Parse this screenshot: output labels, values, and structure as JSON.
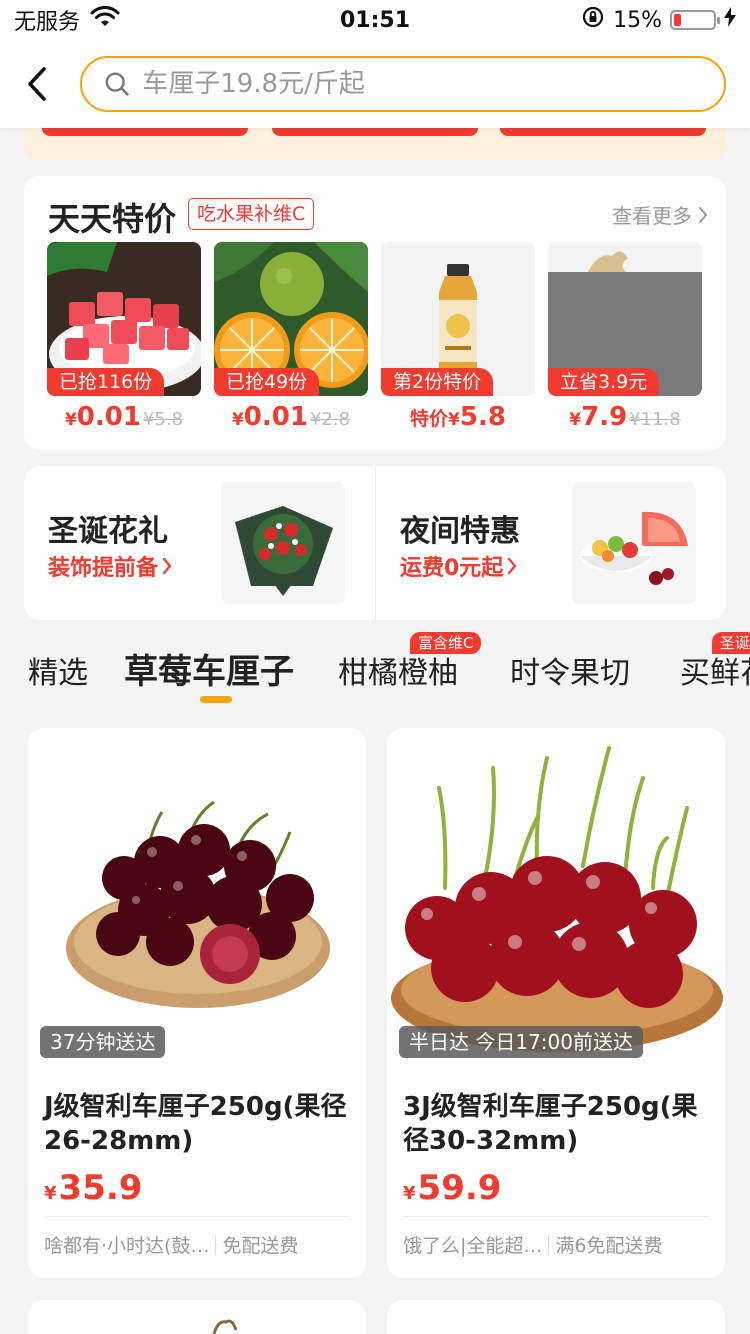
{
  "status_bar": {
    "carrier": "无服务",
    "time": "01:51",
    "battery": "15%"
  },
  "search": {
    "placeholder": "车厘子19.8元/斤起"
  },
  "daily_deals": {
    "title": "天天特价",
    "tag": "吃水果补维C",
    "more": "查看更多",
    "items": [
      {
        "badge": "已抢116份",
        "price_prefix": "",
        "currency": "¥",
        "price": "0.01",
        "original": "¥5.8"
      },
      {
        "badge": "已抢49份",
        "price_prefix": "",
        "currency": "¥",
        "price": "0.01",
        "original": "¥2.8"
      },
      {
        "badge": "第2份特价",
        "price_prefix": "特价",
        "currency": "¥",
        "price": "5.8",
        "original": ""
      },
      {
        "badge": "立省3.9元",
        "price_prefix": "",
        "currency": "¥",
        "price": "7.9",
        "original": "¥11.8"
      }
    ]
  },
  "promos": [
    {
      "title": "圣诞花礼",
      "subtitle": "装饰提前备"
    },
    {
      "title": "夜间特惠",
      "subtitle": "运费0元起"
    }
  ],
  "category_tabs": [
    {
      "label": "精选",
      "badge": ""
    },
    {
      "label": "草莓车厘子",
      "badge": ""
    },
    {
      "label": "柑橘橙柚",
      "badge": "富含维C"
    },
    {
      "label": "时令果切",
      "badge": ""
    },
    {
      "label": "买鲜花",
      "badge": "圣诞"
    }
  ],
  "products": [
    {
      "delivery_badge": "37分钟送达",
      "name": "J级智利车厘子250g(果径26-28mm)",
      "currency": "¥",
      "price": "35.9",
      "shop": "啥都有·小时达(鼓…",
      "shipping": "免配送费"
    },
    {
      "delivery_badge": "半日达 今日17:00前送达",
      "name": "3J级智利车厘子250g(果径30-32mm)",
      "currency": "¥",
      "price": "59.9",
      "shop": "饿了么|全能超…",
      "shipping": "满6免配送费"
    }
  ],
  "colors": {
    "accent": "#f23a2f",
    "brand": "#f5a400"
  }
}
